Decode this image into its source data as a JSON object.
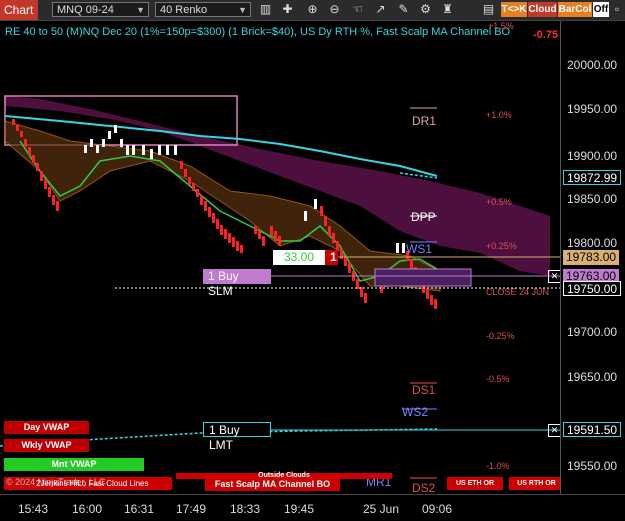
{
  "toolbar": {
    "tab_label": "Chart",
    "instrument": "MNQ 09-24",
    "bar_type": "40 Renko",
    "buttons": [
      {
        "label": "T<>K",
        "color": "#e67e22"
      },
      {
        "label": "Cloud",
        "color": "#c0392b"
      },
      {
        "label": "BarCol",
        "color": "#e67e22"
      },
      {
        "label": "Off",
        "color": "#ffffff"
      }
    ],
    "icons": [
      "chart-bars-icon",
      "crosshair-icon",
      "zoom-in-icon",
      "zoom-out-icon",
      "hand-icon",
      "draw-icon",
      "pencil-icon",
      "settings-icon",
      "strategy-icon",
      "properties-icon"
    ]
  },
  "chart_title": "RE 40 to 50 (M)NQ Dec 20 (1%=150p=$300) (1 Brick=$40), US Dy RTH %, Fast Scalp MA Channel BO",
  "pnl_text": "-0.75",
  "colors": {
    "up": "#ffffff",
    "down": "#ff2020",
    "cloud": "#7a1a5a",
    "cyan": "#35d6e0",
    "orange": "#d67a1a",
    "green": "#2ecc40"
  },
  "y_axis": {
    "labels": [
      "20000.00",
      "19950.00",
      "19900.00",
      "19850.00",
      "19800.00",
      "19700.00",
      "19650.00",
      "19550.00"
    ]
  },
  "price_tags": [
    {
      "label": "19872.99",
      "bg": "#000000",
      "fg": "#ffffff",
      "border": "#35d6e0"
    },
    {
      "label": "19783.00",
      "bg": "#d9b070",
      "fg": "#000000",
      "border": "#d9b070"
    },
    {
      "label": "19763.00",
      "bg": "#c07ad0",
      "fg": "#000000",
      "border": "#c07ad0"
    },
    {
      "label": "19750.00",
      "bg": "#000000",
      "fg": "#ffffff",
      "border": "#ffffff"
    },
    {
      "label": "19591.50",
      "bg": "#000000",
      "fg": "#ffffff",
      "border": "#35d6e0"
    }
  ],
  "time_axis": [
    "15:43",
    "16:00",
    "16:31",
    "17:49",
    "18:33",
    "19:45",
    "25 Jun",
    "09:06"
  ],
  "pivots": [
    {
      "label": "DR1",
      "color": "#e0a0c0"
    },
    {
      "label": "DPP",
      "color": "#ffffff"
    },
    {
      "label": "WS1",
      "color": "#8080ff"
    },
    {
      "label": "DS1",
      "color": "#e05050"
    },
    {
      "label": "WS2",
      "color": "#8080ff"
    },
    {
      "label": "MR1",
      "color": "#8080ff"
    },
    {
      "label": "DS2",
      "color": "#e05050"
    }
  ],
  "percent_labels": [
    "+1.5%",
    "+1.0%",
    "+0.5%",
    "+0.25%",
    "-0.25%",
    "-0.5%",
    "-1.0%"
  ],
  "close_label": "CLOSE 24 JUN",
  "vwap_labels": [
    {
      "label": "Day VWAP",
      "bg": "#c00000"
    },
    {
      "label": "Wkly VWAP",
      "bg": "#c00000"
    },
    {
      "label": "Mnt VWAP",
      "bg": "#22cc22"
    }
  ],
  "orders": {
    "buy_slm": "1 Buy SLM",
    "buy_lmt": "1 Buy LMT",
    "qty_value": "33.00",
    "qty_count": "1"
  },
  "bottom_buttons": {
    "copyright": "© 2024 NinjaTrader, LLC",
    "overlay_text": "2Jenkins HiLo Fast Cloud Lines",
    "fast_scalp": "Fast Scalp MA Channel BO",
    "outside_clouds": "Outside Clouds",
    "us_eth": "US ETH OR",
    "us_rth": "US RTH OR"
  }
}
